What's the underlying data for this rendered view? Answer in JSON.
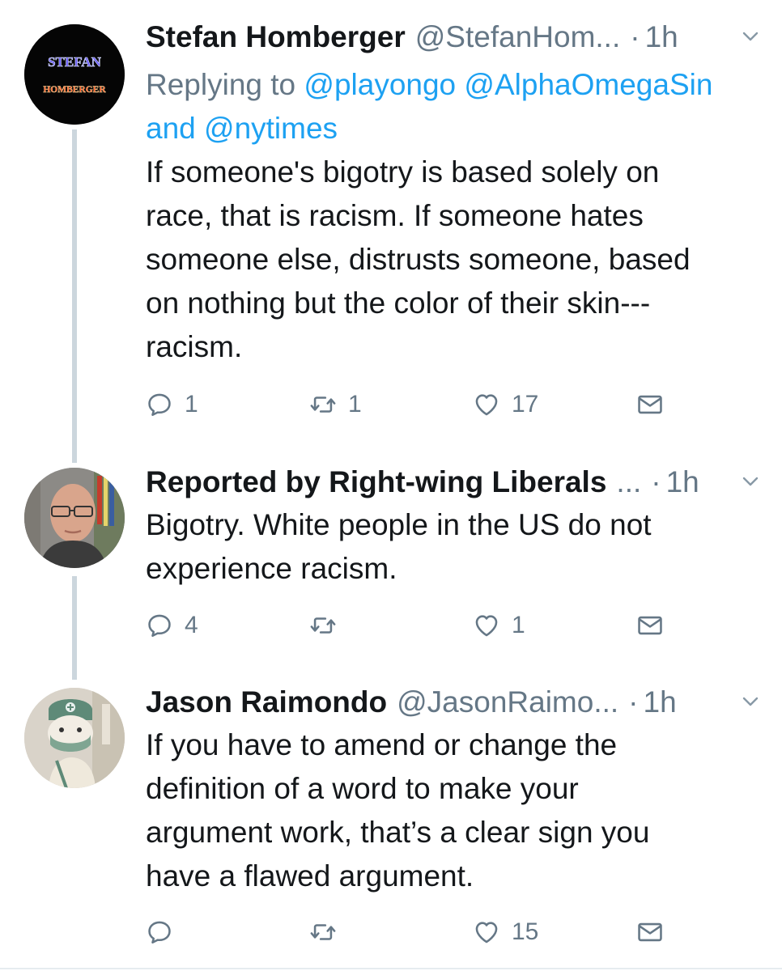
{
  "tweets": [
    {
      "name": "Stefan Homberger",
      "handle": "@StefanHom...",
      "time": "1h",
      "avatar_text": [
        "STEFAN",
        "HOMBERGER"
      ],
      "reply_prefix": "Replying to",
      "reply_mentions": [
        "@playongo",
        "@AlphaOmegaSin"
      ],
      "reply_and": "and",
      "reply_last": "@nytimes",
      "text_lines": [
        "If someone's bigotry is based solely on",
        "race, that is racism. If someone hates",
        "someone else, distrusts someone, based",
        "on nothing but the color of their skin---",
        "racism."
      ],
      "replies": "1",
      "retweets": "1",
      "likes": "17"
    },
    {
      "name": "Reported by Right-wing Liberals",
      "handle": "...",
      "time": "1h",
      "text_lines": [
        "Bigotry. White people in the US do not",
        "experience racism."
      ],
      "replies": "4",
      "retweets": "",
      "likes": "1"
    },
    {
      "name": "Jason Raimondo",
      "handle": "@JasonRaimo...",
      "time": "1h",
      "text_lines": [
        "If you have to amend or change the",
        "definition of a word to make your",
        "argument work, that’s a clear sign you",
        "have a flawed argument."
      ],
      "replies": "",
      "retweets": "",
      "likes": "15"
    }
  ],
  "icons": {
    "reply": "reply-icon",
    "retweet": "retweet-icon",
    "like": "heart-icon",
    "dm": "mail-icon",
    "menu": "chevron-down-icon"
  },
  "colors": {
    "link": "#1da1f2",
    "secondary": "#657786",
    "thread_line": "#ccd6dd"
  }
}
